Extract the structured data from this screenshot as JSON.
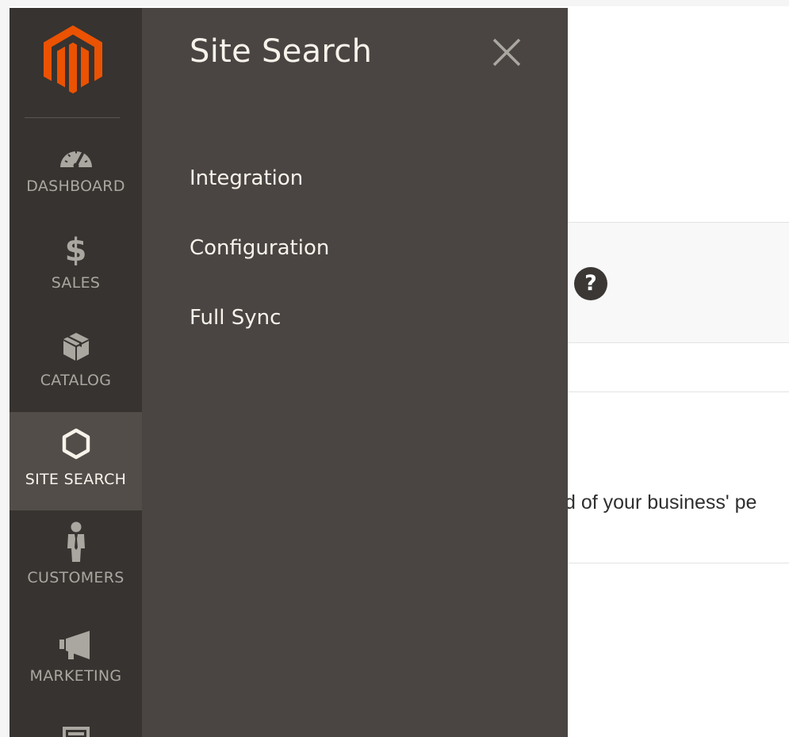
{
  "content": {
    "help_icon_glyph": "?",
    "partial_text": "d of your business' pe"
  },
  "nav": {
    "logo": "magento-logo",
    "items": [
      {
        "label": "DASHBOARD",
        "icon": "dashboard-icon",
        "active": false
      },
      {
        "label": "SALES",
        "icon": "dollar-icon",
        "icon_glyph": "$",
        "active": false
      },
      {
        "label": "CATALOG",
        "icon": "box-icon",
        "active": false
      },
      {
        "label": "SITE SEARCH",
        "icon": "hexagon-icon",
        "active": true
      },
      {
        "label": "CUSTOMERS",
        "icon": "person-icon",
        "active": false
      },
      {
        "label": "MARKETING",
        "icon": "megaphone-icon",
        "active": false
      },
      {
        "label": "",
        "icon": "content-icon",
        "active": false
      }
    ]
  },
  "flyout": {
    "title": "Site Search",
    "close_icon": "close-icon",
    "items": [
      {
        "label": "Integration"
      },
      {
        "label": "Configuration"
      },
      {
        "label": "Full Sync"
      }
    ]
  },
  "colors": {
    "nav_bg": "#373330",
    "nav_active_bg": "#524d49",
    "flyout_bg": "#4a4542",
    "logo_orange": "#eb5202",
    "nav_text": "#aaa6a0",
    "flyout_text": "#f7f3eb"
  }
}
